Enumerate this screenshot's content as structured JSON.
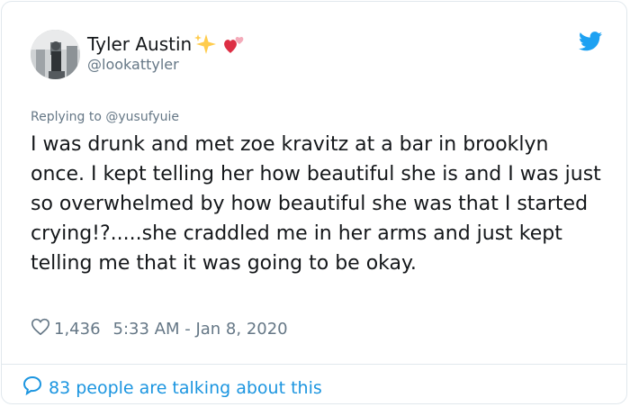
{
  "tweet": {
    "author_name": "Tyler Austin",
    "author_emojis": [
      "sparkles-icon",
      "revolving-hearts-icon"
    ],
    "handle": "@lookattyler",
    "replying_to": "Replying to @yusufyuie",
    "text": "I was drunk and met zoe kravitz at a bar in brooklyn once. I kept telling her how beautiful she is and I was just so overwhelmed by how beautiful she was that I started crying!?.....she craddled me in her arms and just kept telling me that it was going to be okay.",
    "likes": "1,436",
    "timestamp": "5:33 AM - Jan 8, 2020",
    "footer": "83 people are talking about this"
  },
  "colors": {
    "link": "#1b95e0",
    "muted": "#657786",
    "text": "#14171a",
    "border": "#e1e8ed",
    "twitter_blue": "#1da1f2"
  },
  "icons": [
    "twitter-bird-icon",
    "heart-outline-icon",
    "speech-bubble-icon"
  ]
}
